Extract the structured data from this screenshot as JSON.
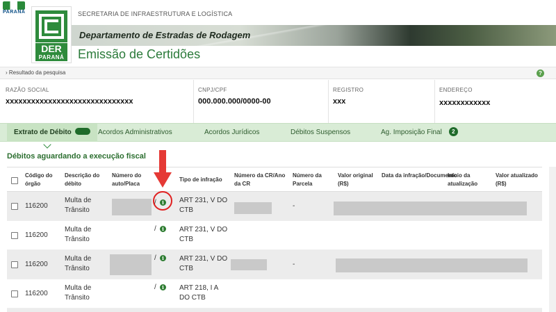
{
  "header": {
    "state_logo_text": "PARANÁ",
    "secretaria": "SECRETARIA DE INFRAESTRUTURA E LOGÍSTICA",
    "department": "Departamento de Estradas de Rodagem",
    "logo_brand": "DER",
    "logo_state": "PARANÁ",
    "page_title": "Emissão de Certidões"
  },
  "breadcrumb": {
    "text": "› Resultado da pesquisa",
    "help_glyph": "?"
  },
  "info": {
    "razao_social": {
      "label": "RAZÃO SOCIAL",
      "value": "xxxxxxxxxxxxxxxxxxxxxxxxxxxxxx"
    },
    "cnpj": {
      "label": "CNPJ/CPF",
      "value": "000.000.000/0000-00"
    },
    "registro": {
      "label": "REGISTRO",
      "value": "xxx"
    },
    "endereco": {
      "label": "ENDEREÇO",
      "value": "xxxxxxxxxxxx"
    }
  },
  "tabs": [
    {
      "label": "Extrato de Débito"
    },
    {
      "label": "Acordos Administrativos"
    },
    {
      "label": "Acordos Jurídicos"
    },
    {
      "label": "Débitos Suspensos"
    },
    {
      "label": "Ag. Imposição Final",
      "count": "2"
    }
  ],
  "section_title": "Débitos aguardando a execução fiscal",
  "table": {
    "headers": {
      "codigo": "Código do órgão",
      "descricao": "Descrição do débito",
      "numero_auto": "Número do auto/Placa",
      "tipo": "Tipo de infração",
      "numero_cr": "Número da CR/Ano da CR",
      "parcela": "Número da Parcela",
      "valor_original": "Valor original (R$)",
      "data": "Data da infração/Documento",
      "inicio": "Início da atualização",
      "valor_atualizado": "Valor atualizado (R$)"
    },
    "rows": [
      {
        "codigo": "116200",
        "descricao": "Multa de Trânsito",
        "slash": "/",
        "tipo": "ART 231, V DO CTB",
        "parcela": "-"
      },
      {
        "codigo": "116200",
        "descricao": "Multa de Trânsito",
        "slash": "/",
        "tipo": "ART 231, V DO CTB",
        "parcela": ""
      },
      {
        "codigo": "116200",
        "descricao": "Multa de Trânsito",
        "slash": "/",
        "tipo": "ART 231, V DO CTB",
        "parcela": "-"
      },
      {
        "codigo": "116200",
        "descricao": "Multa de Trânsito",
        "slash": "/",
        "tipo": "ART 218, I A DO CTB",
        "parcela": ""
      }
    ],
    "info_icon_glyph": "i"
  },
  "colors": {
    "brand_green": "#2e8b3c",
    "tab_bg": "#d9ecd6",
    "annotation_red": "#e02020"
  }
}
